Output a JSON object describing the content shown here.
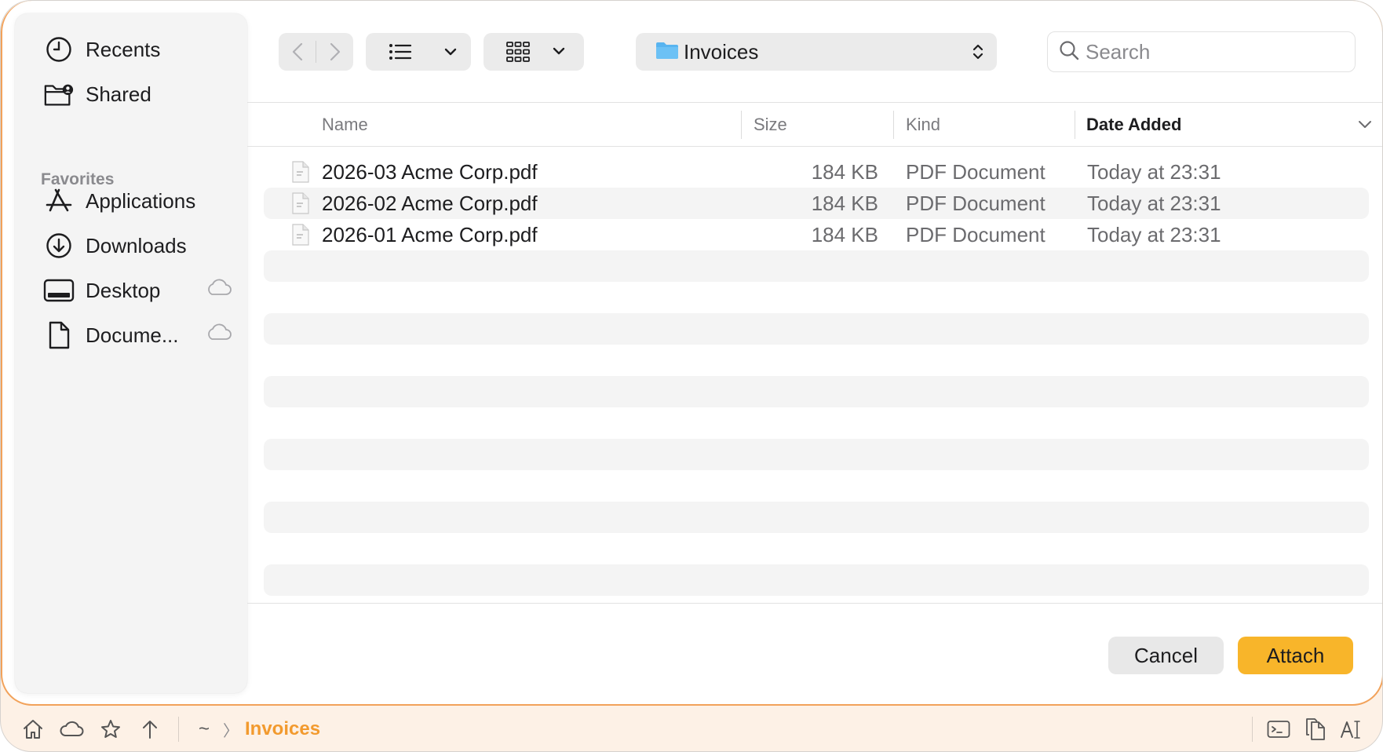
{
  "sidebar": {
    "items": [
      {
        "label": "Recents",
        "icon": "clock-icon"
      },
      {
        "label": "Shared",
        "icon": "shared-folder-icon"
      }
    ],
    "favorites_heading": "Favorites",
    "favorites": [
      {
        "label": "Applications",
        "icon": "applications-icon"
      },
      {
        "label": "Downloads",
        "icon": "download-icon"
      },
      {
        "label": "Desktop",
        "icon": "desktop-icon",
        "cloud": true
      },
      {
        "label": "Docume...",
        "icon": "document-icon",
        "cloud": true
      }
    ]
  },
  "toolbar": {
    "location": "Invoices",
    "search_placeholder": "Search"
  },
  "columns": {
    "name": "Name",
    "size": "Size",
    "kind": "Kind",
    "date_added": "Date Added"
  },
  "files": [
    {
      "name": "2026-03 Acme Corp.pdf",
      "size": "184 KB",
      "kind": "PDF Document",
      "date_added": "Today at 23:31"
    },
    {
      "name": "2026-02 Acme Corp.pdf",
      "size": "184 KB",
      "kind": "PDF Document",
      "date_added": "Today at 23:31"
    },
    {
      "name": "2026-01 Acme Corp.pdf",
      "size": "184 KB",
      "kind": "PDF Document",
      "date_added": "Today at 23:31"
    }
  ],
  "buttons": {
    "cancel": "Cancel",
    "attach": "Attach"
  },
  "statusbar": {
    "home_crumb": "~",
    "separator": "〉",
    "current_crumb": "Invoices"
  },
  "colors": {
    "accent": "#f8b52a",
    "breadcrumb_accent": "#f29a2e",
    "frame_border": "#f2a25a"
  }
}
